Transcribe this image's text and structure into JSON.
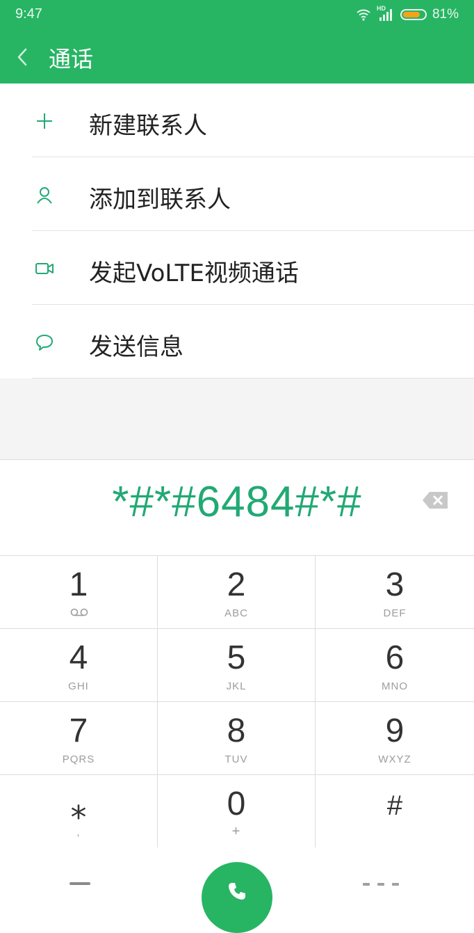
{
  "status_bar": {
    "time": "9:47",
    "network": "HD",
    "battery": "81%",
    "battery_level": 0.81
  },
  "header": {
    "title": "通话"
  },
  "menu": {
    "items": [
      {
        "label": "新建联系人",
        "icon": "plus-icon"
      },
      {
        "label": "添加到联系人",
        "icon": "person-icon"
      },
      {
        "label": "发起VoLTE视频通话",
        "icon": "video-camera-icon"
      },
      {
        "label": "发送信息",
        "icon": "message-bubble-icon"
      }
    ]
  },
  "dialer": {
    "number": "*#*#6484#*#"
  },
  "keypad": {
    "keys": [
      {
        "digit": "1",
        "sub": "",
        "sub_icon": "voicemail-icon"
      },
      {
        "digit": "2",
        "sub": "ABC"
      },
      {
        "digit": "3",
        "sub": "DEF"
      },
      {
        "digit": "4",
        "sub": "GHI"
      },
      {
        "digit": "5",
        "sub": "JKL"
      },
      {
        "digit": "6",
        "sub": "MNO"
      },
      {
        "digit": "7",
        "sub": "PQRS"
      },
      {
        "digit": "8",
        "sub": "TUV"
      },
      {
        "digit": "9",
        "sub": "WXYZ"
      },
      {
        "digit": "⁎",
        "sub": ","
      },
      {
        "digit": "0",
        "sub": "+"
      },
      {
        "digit": "#",
        "sub": ""
      }
    ]
  },
  "colors": {
    "accent": "#27b564",
    "number_text": "#21a974"
  }
}
